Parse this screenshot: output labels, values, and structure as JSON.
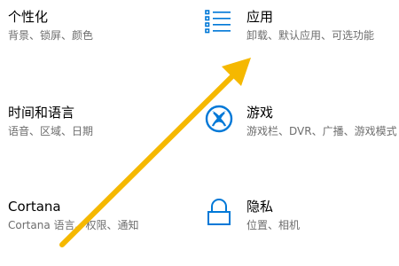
{
  "tiles": {
    "personalization": {
      "title": "个性化",
      "desc": "背景、锁屏、颜色",
      "icon": ""
    },
    "time_language": {
      "title": "时间和语言",
      "desc": "语音、区域、日期",
      "icon": ""
    },
    "cortana": {
      "title": "Cortana",
      "desc": "Cortana 语言、权限、通知",
      "icon": ""
    },
    "apps": {
      "title": "应用",
      "desc": "卸载、默认应用、可选功能",
      "icon": "apps-list-icon"
    },
    "gaming": {
      "title": "游戏",
      "desc": "游戏栏、DVR、广播、游戏模式",
      "icon": "xbox-icon"
    },
    "privacy": {
      "title": "隐私",
      "desc": "位置、相机",
      "icon": "lock-icon"
    }
  },
  "colors": {
    "accent": "#0078d7",
    "annotation_arrow": "#f5b800",
    "title": "#000000",
    "description": "#6d6d6d"
  }
}
